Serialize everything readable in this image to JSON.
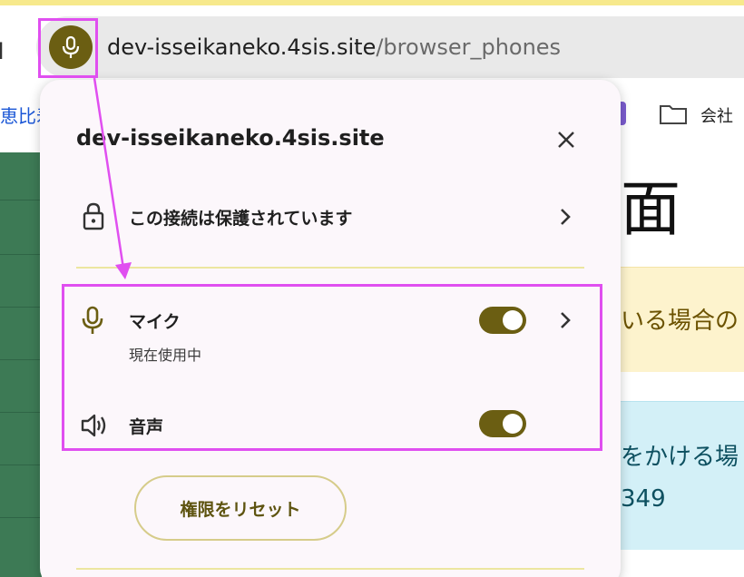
{
  "browser": {
    "left_glyph": "ı",
    "url_host": "dev-isseikaneko.4sis.site",
    "url_path": "/browser_phones",
    "site_chip_icon": "microphone-icon",
    "accent": "#6b5e12"
  },
  "bookmarks": {
    "left_fragment": "恵比寿",
    "right_label": "会社",
    "folder_icon": "folder-icon"
  },
  "background_page": {
    "heading_fragment": "面",
    "warning_fragment": "いる場合の",
    "info_line1_fragment": "をかける場",
    "info_line2_fragment": "349"
  },
  "site_info_popup": {
    "title": "dev-isseikaneko.4sis.site",
    "close_icon": "close-icon",
    "connection": {
      "label": "この接続は保護されています",
      "icon": "lock-icon"
    },
    "permissions": [
      {
        "label": "マイク",
        "status": "現在使用中",
        "icon": "microphone-icon",
        "enabled": true
      },
      {
        "label": "音声",
        "icon": "speaker-icon",
        "enabled": true
      }
    ],
    "reset_button": "権限をリセット"
  },
  "annotation": {
    "color": "#e04ff0"
  }
}
